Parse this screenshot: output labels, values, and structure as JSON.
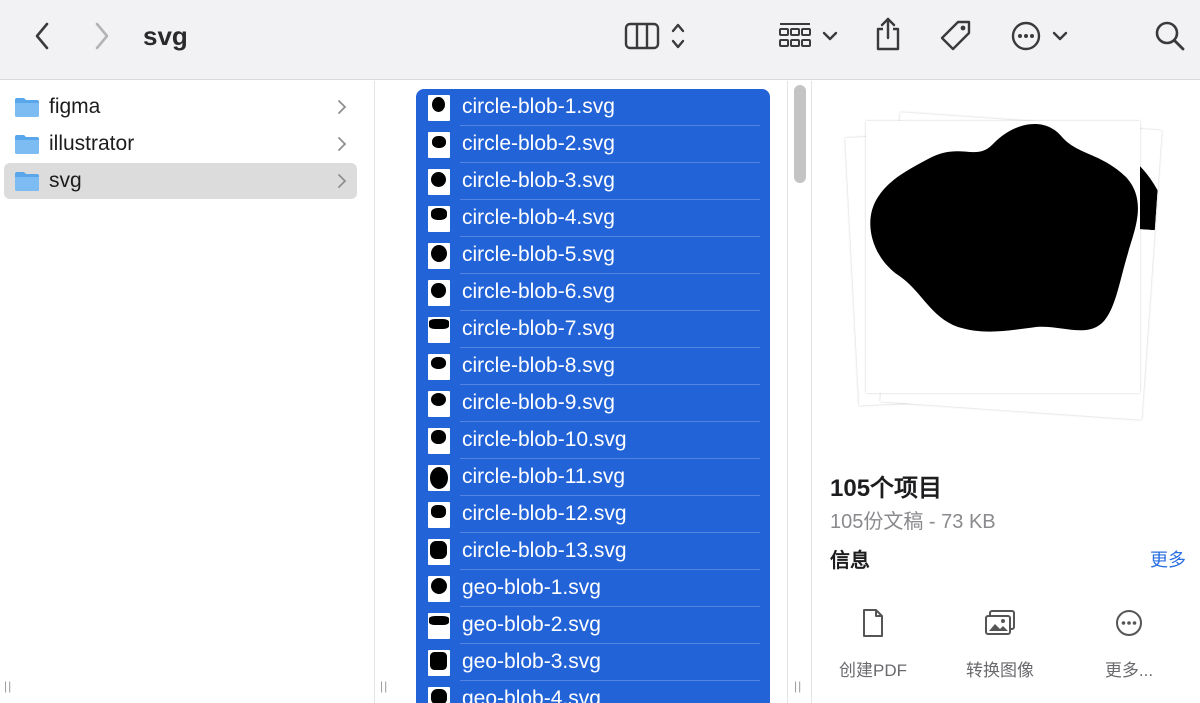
{
  "window": {
    "title": "svg"
  },
  "toolbar": {
    "back_icon": "chevron-left-icon",
    "forward_icon": "chevron-right-icon",
    "view_columns_icon": "columns-icon",
    "group_icon": "grid-icon",
    "share_icon": "share-icon",
    "tag_icon": "tag-icon",
    "more_icon": "ellipsis-circle-icon",
    "search_icon": "search-icon"
  },
  "sidebar": {
    "items": [
      {
        "label": "figma"
      },
      {
        "label": "illustrator"
      },
      {
        "label": "svg",
        "selected": true
      }
    ]
  },
  "files": {
    "items": [
      {
        "label": "circle-blob-1.svg"
      },
      {
        "label": "circle-blob-2.svg"
      },
      {
        "label": "circle-blob-3.svg"
      },
      {
        "label": "circle-blob-4.svg"
      },
      {
        "label": "circle-blob-5.svg"
      },
      {
        "label": "circle-blob-6.svg"
      },
      {
        "label": "circle-blob-7.svg"
      },
      {
        "label": "circle-blob-8.svg"
      },
      {
        "label": "circle-blob-9.svg"
      },
      {
        "label": "circle-blob-10.svg"
      },
      {
        "label": "circle-blob-11.svg"
      },
      {
        "label": "circle-blob-12.svg"
      },
      {
        "label": "circle-blob-13.svg"
      },
      {
        "label": "geo-blob-1.svg"
      },
      {
        "label": "geo-blob-2.svg"
      },
      {
        "label": "geo-blob-3.svg"
      },
      {
        "label": "geo-blob-4.svg"
      }
    ]
  },
  "preview": {
    "title": "105个项目",
    "subtitle": "105份文稿 - 73 KB",
    "info_heading": "信息",
    "more_link": "更多",
    "actions": [
      {
        "label": "创建PDF",
        "icon": "document-icon"
      },
      {
        "label": "转换图像",
        "icon": "photos-icon"
      },
      {
        "label": "更多...",
        "icon": "ellipsis-circle-icon"
      }
    ]
  },
  "colors": {
    "selection": "#2363d8",
    "folder": "#5aa6ea",
    "link": "#2a6fe0"
  }
}
